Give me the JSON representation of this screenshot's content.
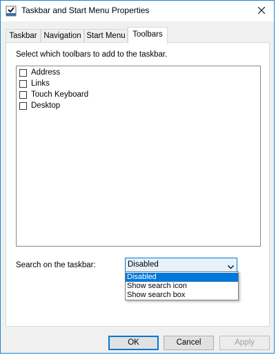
{
  "window": {
    "title": "Taskbar and Start Menu Properties",
    "accent": "#0078d7"
  },
  "icons": {
    "app": "taskbar-properties-icon",
    "close": "close-icon",
    "dropdown": "chevron-down-icon"
  },
  "tabs": [
    {
      "label": "Taskbar",
      "active": false
    },
    {
      "label": "Navigation",
      "active": false
    },
    {
      "label": "Start Menu",
      "active": false
    },
    {
      "label": "Toolbars",
      "active": true
    }
  ],
  "toolbars": {
    "instruction": "Select which toolbars to add to the taskbar.",
    "items": [
      {
        "label": "Address",
        "checked": false
      },
      {
        "label": "Links",
        "checked": false
      },
      {
        "label": "Touch Keyboard",
        "checked": false
      },
      {
        "label": "Desktop",
        "checked": false
      }
    ]
  },
  "search": {
    "label": "Search on the taskbar:",
    "selected": "Disabled",
    "options": [
      "Disabled",
      "Show search icon",
      "Show search box"
    ]
  },
  "buttons": {
    "ok": "OK",
    "cancel": "Cancel",
    "apply": "Apply"
  }
}
